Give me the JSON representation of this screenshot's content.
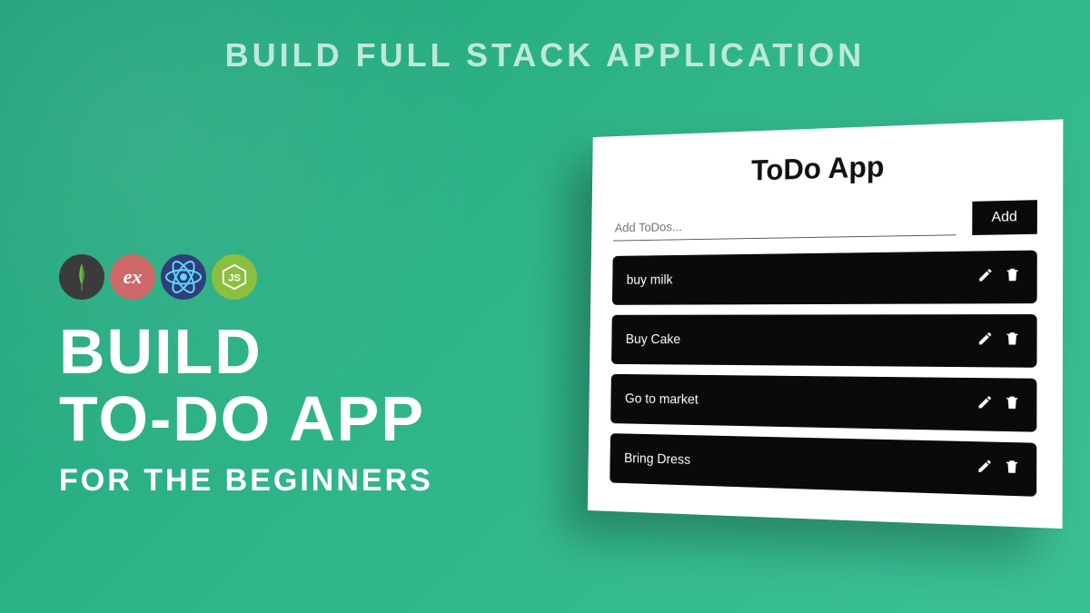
{
  "header": "BUILD FULL STACK APPLICATION",
  "left": {
    "line1": "BUILD",
    "line2": "TO-DO APP",
    "line3": "FOR THE BEGINNERS",
    "icons": {
      "mongo": "mongodb-icon",
      "express": "ex",
      "react": "react-icon",
      "node": "nodejs-icon"
    }
  },
  "app": {
    "title": "ToDo App",
    "input_placeholder": "Add ToDos...",
    "add_label": "Add",
    "items": [
      {
        "text": "buy milk"
      },
      {
        "text": "Buy Cake"
      },
      {
        "text": "Go to market"
      },
      {
        "text": "Bring Dress"
      }
    ]
  }
}
